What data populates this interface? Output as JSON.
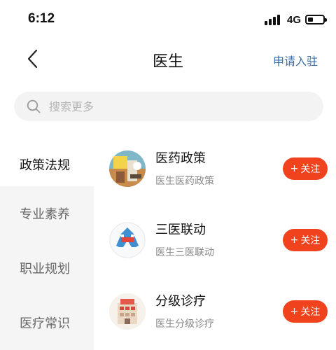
{
  "status_bar": {
    "time": "6:12",
    "network": "4G"
  },
  "nav": {
    "title": "医生",
    "action_label": "申请入驻"
  },
  "search": {
    "placeholder": "搜索更多"
  },
  "sidebar": {
    "items": [
      {
        "label": "政策法规",
        "active": true
      },
      {
        "label": "专业素养",
        "active": false
      },
      {
        "label": "职业规划",
        "active": false
      },
      {
        "label": "医疗常识",
        "active": false
      }
    ]
  },
  "channels": [
    {
      "title": "医药政策",
      "subtitle": "医生医药政策",
      "follow_plus": "+",
      "follow_label": "关注",
      "icon": "medicine-policy-icon"
    },
    {
      "title": "三医联动",
      "subtitle": "医生三医联动",
      "follow_plus": "+",
      "follow_label": "关注",
      "icon": "three-medical-linkage-icon"
    },
    {
      "title": "分级诊疗",
      "subtitle": "医生分级诊疗",
      "follow_plus": "+",
      "follow_label": "关注",
      "icon": "tiered-treatment-icon"
    }
  ],
  "colors": {
    "accent": "#f0421c",
    "link": "#3a6ea8",
    "sidebar_bg": "#f5f5f5",
    "search_bg": "#f3f3f3"
  }
}
